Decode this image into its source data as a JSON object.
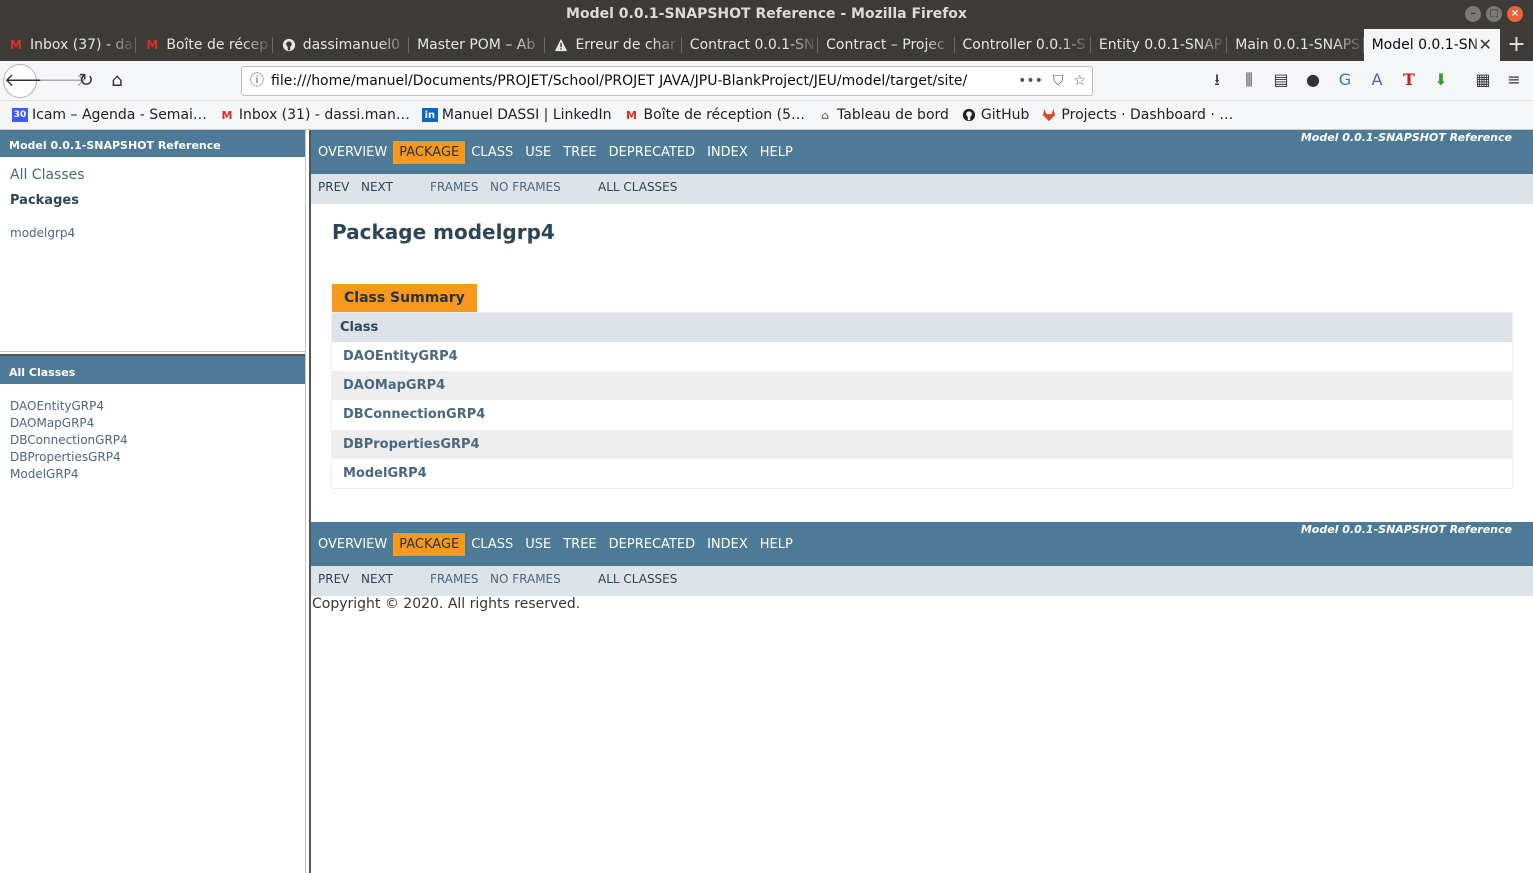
{
  "window": {
    "title": "Model 0.0.1-SNAPSHOT Reference - Mozilla Firefox"
  },
  "tabs": [
    {
      "label": "Inbox (37) - da",
      "icon": "gmail-icon"
    },
    {
      "label": "Boîte de récep",
      "icon": "gmail-icon"
    },
    {
      "label": "dassimanuel0",
      "icon": "github-icon"
    },
    {
      "label": "Master POM – Ab",
      "icon": ""
    },
    {
      "label": "Erreur de char",
      "icon": "warning-icon"
    },
    {
      "label": "Contract 0.0.1-SN",
      "icon": ""
    },
    {
      "label": "Contract – Projec",
      "icon": ""
    },
    {
      "label": "Controller 0.0.1-S",
      "icon": ""
    },
    {
      "label": "Entity 0.0.1-SNAP",
      "icon": ""
    },
    {
      "label": "Main 0.0.1-SNAPS",
      "icon": ""
    },
    {
      "label": "Model 0.0.1-SN",
      "icon": "",
      "active": true
    }
  ],
  "url": "file:///home/manuel/Documents/PROJET/School/PROJET JAVA/JPU-BlankProject/JEU/model/target/site/",
  "url_more": "•••",
  "bookmarks": [
    {
      "label": "Icam – Agenda - Semai…",
      "icon": "calendar-icon"
    },
    {
      "label": "Inbox (31) - dassi.man…",
      "icon": "gmail-icon"
    },
    {
      "label": "Manuel DASSI | LinkedIn",
      "icon": "linkedin-icon"
    },
    {
      "label": "Boîte de réception (5…",
      "icon": "gmail-icon"
    },
    {
      "label": "Tableau de bord",
      "icon": "moodle-icon"
    },
    {
      "label": "GitHub",
      "icon": "github-icon"
    },
    {
      "label": "Projects · Dashboard · …",
      "icon": "gitlab-icon"
    }
  ],
  "left": {
    "top_header": "Model 0.0.1-SNAPSHOT Reference",
    "all_classes_link": "All Classes",
    "packages_heading": "Packages",
    "packages": [
      "modelgrp4"
    ],
    "bottom_header": "All Classes",
    "classes": [
      "DAOEntityGRP4",
      "DAOMapGRP4",
      "DBConnectionGRP4",
      "DBPropertiesGRP4",
      "ModelGRP4"
    ]
  },
  "main": {
    "reference_label": "Model 0.0.1-SNAPSHOT Reference",
    "nav": [
      "OVERVIEW",
      "PACKAGE",
      "CLASS",
      "USE",
      "TREE",
      "DEPRECATED",
      "INDEX",
      "HELP"
    ],
    "current_nav": "PACKAGE",
    "subnav": {
      "prev": "PREV",
      "next": "NEXT",
      "frames": "FRAMES",
      "no_frames": "NO FRAMES",
      "all_classes": "ALL CLASSES"
    },
    "package_title": "Package modelgrp4",
    "summary_caption": "Class Summary",
    "table_header": "Class",
    "classes": [
      "DAOEntityGRP4",
      "DAOMapGRP4",
      "DBConnectionGRP4",
      "DBPropertiesGRP4",
      "ModelGRP4"
    ],
    "copyright": "Copyright © 2020. All rights reserved."
  },
  "colors": {
    "javadoc_blue": "#4d7a97",
    "javadoc_orange": "#f8981d",
    "subnav_bg": "#dee3e9",
    "link": "#4a6782"
  }
}
